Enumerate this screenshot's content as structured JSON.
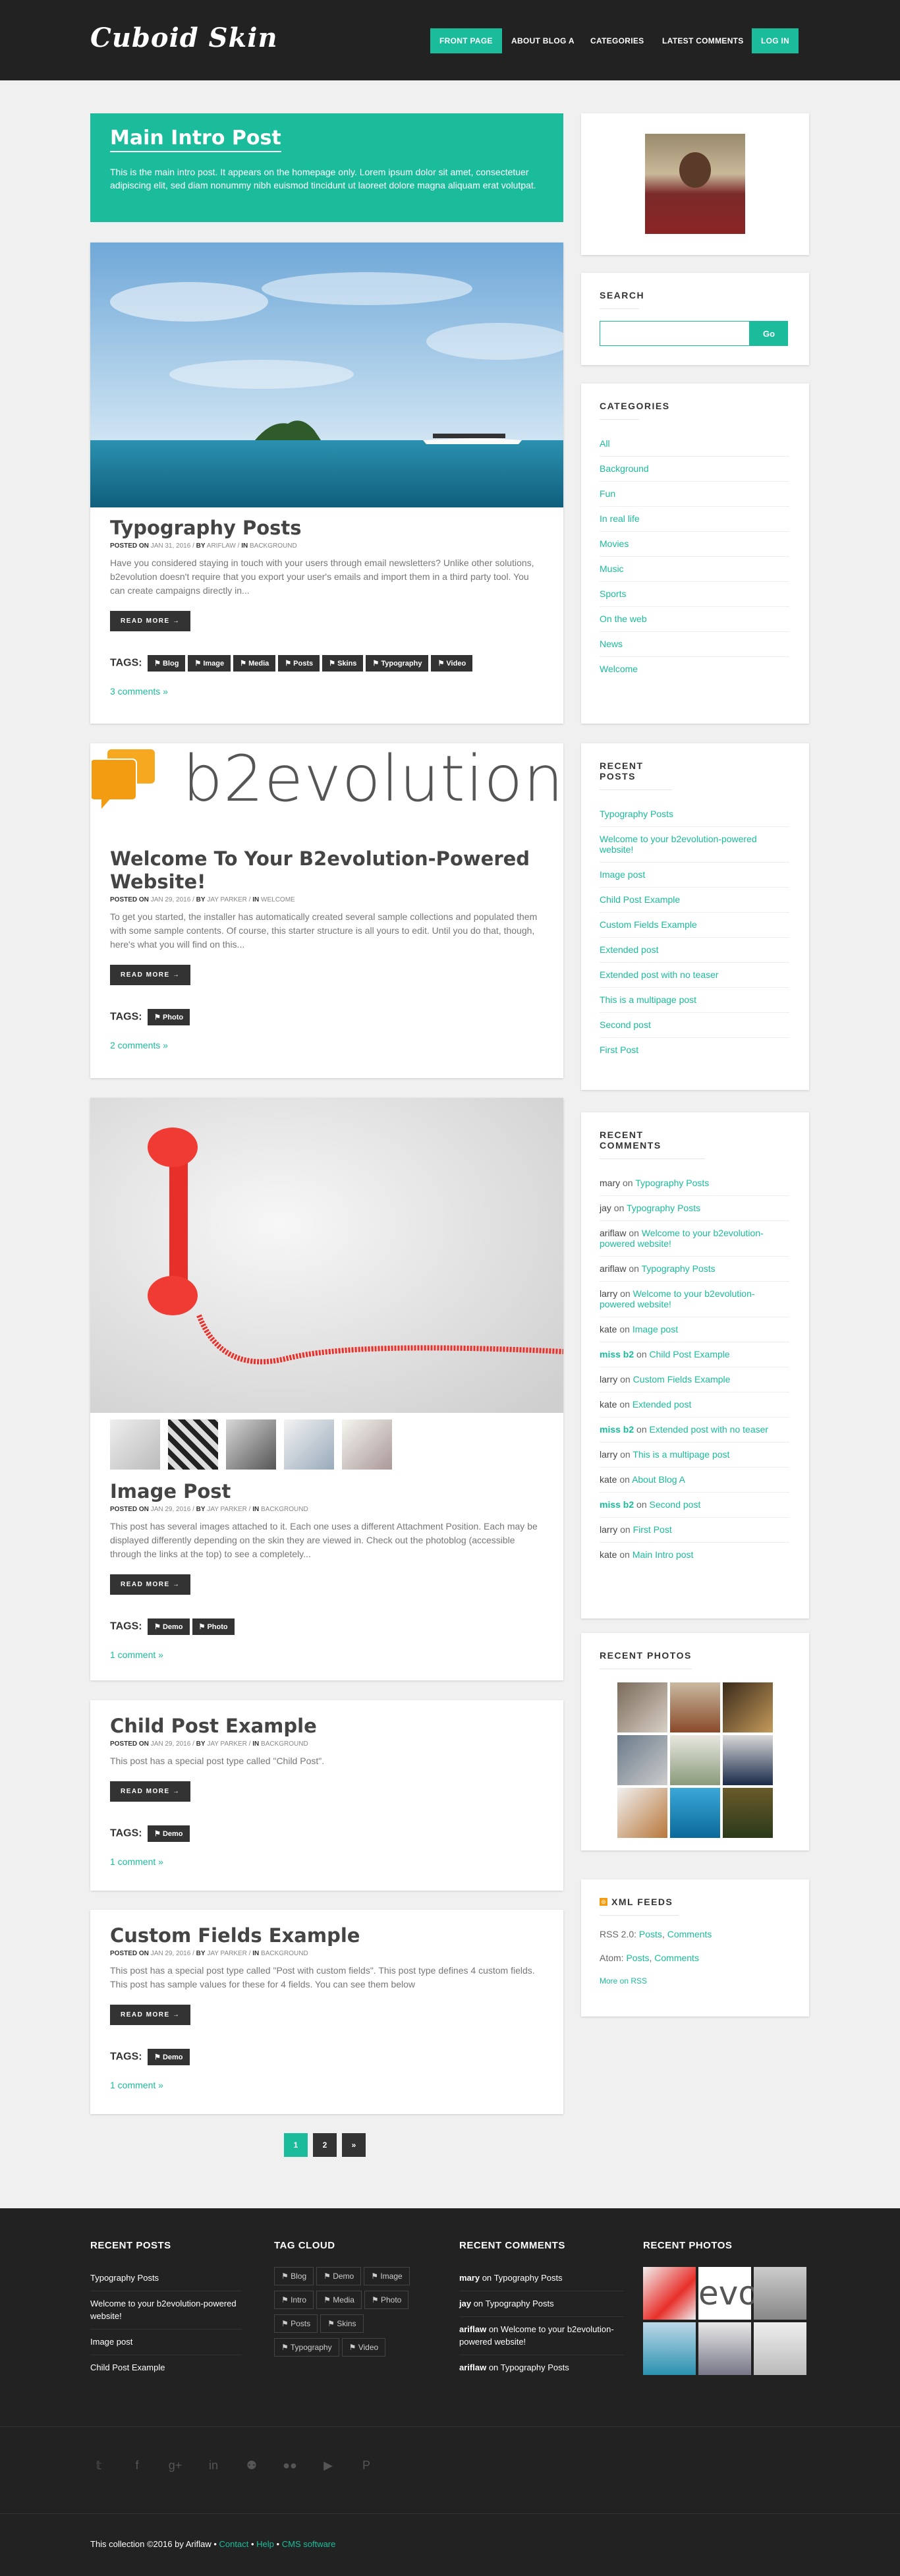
{
  "brand": "Cuboid Skin",
  "nav": [
    {
      "label": "Front Page",
      "active": true
    },
    {
      "label": "About Blog A",
      "active": false
    },
    {
      "label": "Categories",
      "active": false
    },
    {
      "label": "Latest Comments",
      "active": false
    },
    {
      "label": "Log In",
      "active": true
    }
  ],
  "intro": {
    "title": "Main Intro Post",
    "text": "This is the main intro post. It appears on the homepage only. Lorem ipsum dolor sit amet, consectetuer adipiscing elit, sed diam nonummy nibh euismod tincidunt ut laoreet dolore magna aliquam erat volutpat."
  },
  "posts": [
    {
      "title": "Typography Posts",
      "meta": {
        "posted_on": "Posted on",
        "date": "Jan 31, 2016",
        "by": "By",
        "author": "Ariflaw",
        "in": "In",
        "category": "Background"
      },
      "excerpt": "Have you considered staying in touch with your users through email newsletters? Unlike other solutions, b2evolution doesn't require that you export your user's emails and import them in a third party tool. You can create campaigns directly in...",
      "read_more": "READ MORE →",
      "tags_label": "TAGS:",
      "tags": [
        "Blog",
        "Image",
        "Media",
        "Posts",
        "Skins",
        "Typography",
        "Video"
      ],
      "comments": "3 comments »"
    },
    {
      "title": "Welcome To Your B2evolution-Powered Website!",
      "logo_text": "b2evolution",
      "meta": {
        "posted_on": "Posted on",
        "date": "Jan 29, 2016",
        "by": "By",
        "author": "Jay Parker",
        "in": "In",
        "category": "Welcome"
      },
      "excerpt": "To get you started, the installer has automatically created several sample collections and populated them with some sample contents. Of course, this starter structure is all yours to edit. Until you do that, though, here's what you will find on this...",
      "read_more": "READ MORE →",
      "tags_label": "TAGS:",
      "tags": [
        "Photo"
      ],
      "comments": "2 comments »"
    },
    {
      "title": "Image Post",
      "meta": {
        "posted_on": "Posted on",
        "date": "Jan 29, 2016",
        "by": "By",
        "author": "Jay Parker",
        "in": "In",
        "category": "Background"
      },
      "excerpt": "This post has several images attached to it. Each one uses a different Attachment Position. Each may be displayed differently depending on the skin they are viewed in. Check out the photoblog (accessible through the links at the top) to see a completely...",
      "read_more": "READ MORE →",
      "tags_label": "TAGS:",
      "tags": [
        "Demo",
        "Photo"
      ],
      "comments": "1 comment »"
    },
    {
      "title": "Child Post Example",
      "meta": {
        "posted_on": "Posted on",
        "date": "Jan 29, 2016",
        "by": "By",
        "author": "Jay Parker",
        "in": "In",
        "category": "Background"
      },
      "excerpt": "This post has a special post type called \"Child Post\".",
      "read_more": "READ MORE →",
      "tags_label": "TAGS:",
      "tags": [
        "Demo"
      ],
      "comments": "1 comment »"
    },
    {
      "title": "Custom Fields Example",
      "meta": {
        "posted_on": "Posted on",
        "date": "Jan 29, 2016",
        "by": "By",
        "author": "Jay Parker",
        "in": "In",
        "category": "Background"
      },
      "excerpt": "This post has a special post type called \"Post with custom fields\". This post type defines 4 custom fields. This post has sample values for these for 4 fields. You can see them below",
      "read_more": "READ MORE →",
      "tags_label": "TAGS:",
      "tags": [
        "Demo"
      ],
      "comments": "1 comment »"
    }
  ],
  "pagination": {
    "pages": [
      "1",
      "2"
    ],
    "next": "»",
    "current": "1"
  },
  "sidebar": {
    "search": {
      "title": "Search",
      "button": "Go",
      "value": ""
    },
    "categories": {
      "title": "Categories",
      "items": [
        "All",
        "Background",
        "Fun",
        "In real life",
        "Movies",
        "Music",
        "Sports",
        "On the web",
        "News",
        "Welcome"
      ]
    },
    "recent_posts": {
      "title": "Recent Posts",
      "items": [
        "Typography Posts",
        "Welcome to your b2evolution-powered website!",
        "Image post",
        "Child Post Example",
        "Custom Fields Example",
        "Extended post",
        "Extended post with no teaser",
        "This is a multipage post",
        "Second post",
        "First Post"
      ]
    },
    "recent_comments": {
      "title": "Recent Comments",
      "on": "on",
      "items": [
        {
          "user": "mary",
          "bold": false,
          "post": "Typography Posts"
        },
        {
          "user": "jay",
          "bold": false,
          "post": "Typography Posts"
        },
        {
          "user": "ariflaw",
          "bold": false,
          "post": "Welcome to your b2evolution-powered website!"
        },
        {
          "user": "ariflaw",
          "bold": false,
          "post": "Typography Posts"
        },
        {
          "user": "larry",
          "bold": false,
          "post": "Welcome to your b2evolution-powered website!"
        },
        {
          "user": "kate",
          "bold": false,
          "post": "Image post"
        },
        {
          "user": "miss b2",
          "bold": true,
          "post": "Child Post Example"
        },
        {
          "user": "larry",
          "bold": false,
          "post": "Custom Fields Example"
        },
        {
          "user": "kate",
          "bold": false,
          "post": "Extended post"
        },
        {
          "user": "miss b2",
          "bold": true,
          "post": "Extended post with no teaser"
        },
        {
          "user": "larry",
          "bold": false,
          "post": "This is a multipage post"
        },
        {
          "user": "kate",
          "bold": false,
          "post": "About Blog A"
        },
        {
          "user": "miss b2",
          "bold": true,
          "post": "Second post"
        },
        {
          "user": "larry",
          "bold": false,
          "post": "First Post"
        },
        {
          "user": "kate",
          "bold": false,
          "post": "Main Intro post"
        }
      ]
    },
    "recent_photos": {
      "title": "Recent Photos"
    },
    "xml_feeds": {
      "title": "XML Feeds",
      "rss_label": "RSS 2.0:",
      "atom_label": "Atom:",
      "posts": "Posts",
      "comments": "Comments",
      "sep": ", ",
      "more": "More on RSS"
    }
  },
  "footer": {
    "recent_posts": {
      "title": "Recent Posts",
      "items": [
        "Typography Posts",
        "Welcome to your b2evolution-powered website!",
        "Image post",
        "Child Post Example"
      ]
    },
    "tag_cloud": {
      "title": "Tag Cloud",
      "tags": [
        "Blog",
        "Demo",
        "Image",
        "Intro",
        "Media",
        "Photo",
        "Posts",
        "Skins",
        "Typography",
        "Video"
      ]
    },
    "recent_comments": {
      "title": "Recent Comments",
      "on": "on",
      "items": [
        {
          "user": "mary",
          "post": "Typography Posts"
        },
        {
          "user": "jay",
          "post": "Typography Posts"
        },
        {
          "user": "ariflaw",
          "post": "Welcome to your b2evolution-powered website!"
        },
        {
          "user": "ariflaw",
          "post": "Typography Posts"
        }
      ]
    },
    "recent_photos": {
      "title": "Recent Photos"
    },
    "social_icons": [
      "twitter-icon",
      "facebook-icon",
      "google-plus-icon",
      "linkedin-icon",
      "github-icon",
      "flickr-icon",
      "youtube-icon",
      "pinterest-icon"
    ],
    "copyright": "This collection ©2016 by Ariflaw",
    "links": [
      "Contact",
      "Help",
      "CMS software"
    ],
    "bullet": "•"
  },
  "colors": {
    "accent": "#1abc9c",
    "dark": "#222222"
  }
}
